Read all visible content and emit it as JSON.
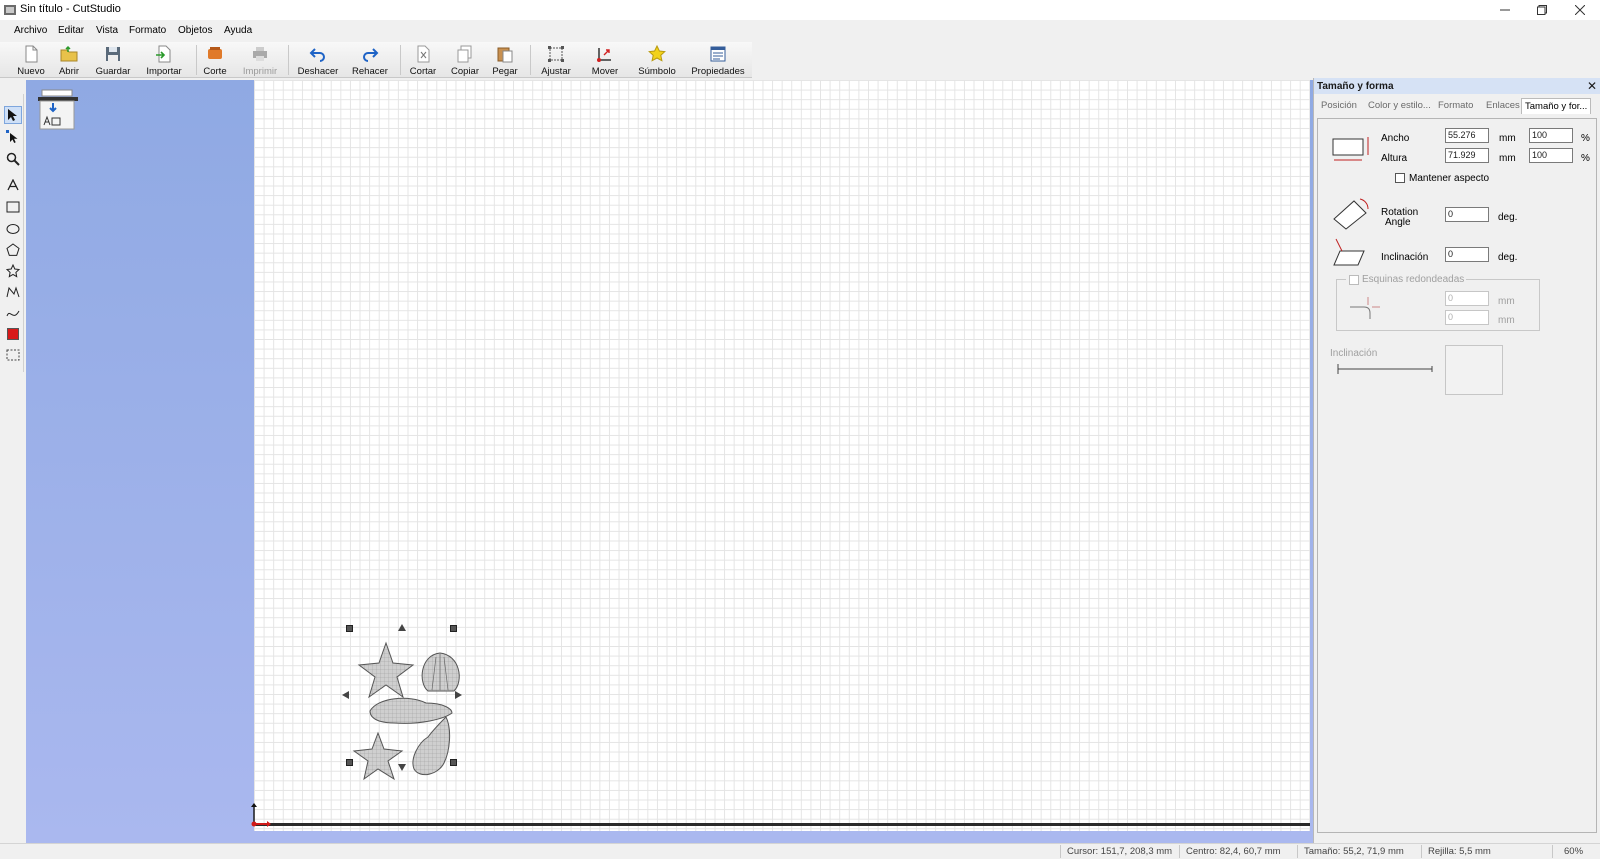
{
  "window": {
    "title": "Sin título - CutStudio"
  },
  "menu": [
    "Archivo",
    "Editar",
    "Vista",
    "Formato",
    "Objetos",
    "Ayuda"
  ],
  "toolbar": {
    "nuevo": "Nuevo",
    "abrir": "Abrir",
    "guardar": "Guardar",
    "importar": "Importar",
    "corte": "Corte",
    "imprimir": "Imprimir",
    "deshacer": "Deshacer",
    "rehacer": "Rehacer",
    "cortar": "Cortar",
    "copiar": "Copiar",
    "pegar": "Pegar",
    "ajustar": "Ajustar",
    "mover": "Mover",
    "simbolo": "Súmbolo",
    "propiedades": "Propiedades"
  },
  "panel": {
    "title": "Tamaño y forma",
    "tabs": [
      "Posición",
      "Color y estilo...",
      "Formato",
      "Enlaces",
      "Tamaño y for..."
    ],
    "active_tab": 4,
    "ancho_label": "Ancho",
    "ancho_value": "55.276",
    "ancho_unit": "mm",
    "ancho_pct": "100",
    "altura_label": "Altura",
    "altura_value": "71.929",
    "altura_unit": "mm",
    "altura_pct": "100",
    "pct_symbol": "%",
    "mantener_label": "Mantener aspecto",
    "rotation_label_1": "Rotation",
    "rotation_label_2": "Angle",
    "rotation_value": "0",
    "rotation_unit": "deg.",
    "inclinacion_label": "Inclinación",
    "inclinacion_value": "0",
    "inclinacion_unit": "deg.",
    "esquinas_label": "Esquinas redondeadas",
    "esquina_1": "0",
    "esquina_2": "0",
    "esquina_unit": "mm",
    "inclinacion2_label": "Inclinación"
  },
  "status": {
    "cursor": "Cursor: 151,7, 208,3 mm",
    "centro": "Centro: 82,4, 60,7 mm",
    "tamano": "Tamaño: 55,2, 71,9 mm",
    "rejilla": "Rejilla: 5,5 mm",
    "zoom": "60%"
  },
  "colors": {
    "accent_blue": "#1e63c6",
    "canvas_bg": "#ffffff",
    "workspace_blue": "#9db2ea"
  },
  "icons": [
    "app-icon",
    "minimize-icon",
    "maximize-icon",
    "close-icon"
  ]
}
